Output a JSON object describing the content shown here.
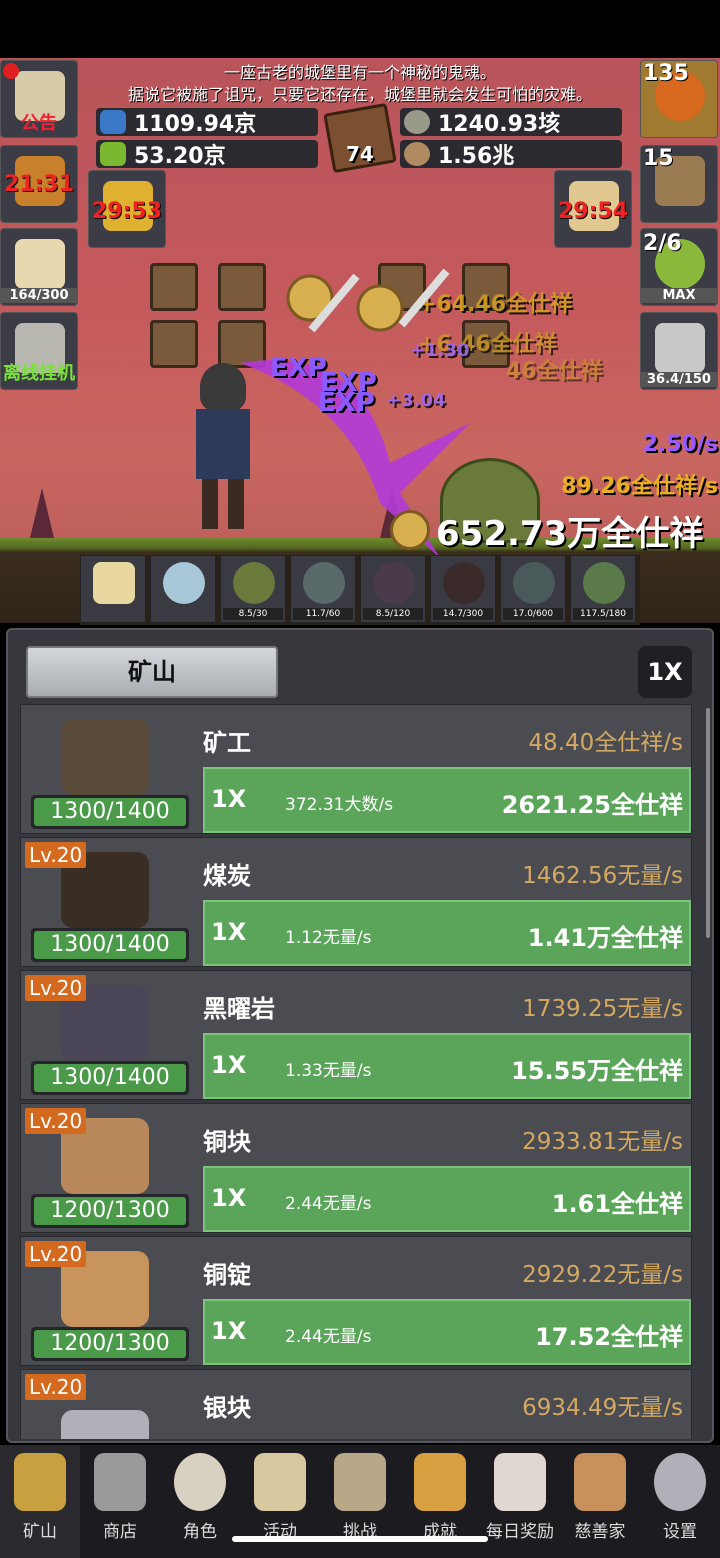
{
  "story": {
    "line1": "一座古老的城堡里有一个神秘的鬼魂。",
    "line2": "据说它被施了诅咒，只要它还存在，城堡里就会发生可怕的灾难。"
  },
  "resources": {
    "blue_potion": "1109.94京",
    "green_potion": "53.20京",
    "book_count": "74",
    "coin_a": "1240.93垓",
    "coin_b": "1.56兆"
  },
  "left_side": {
    "notice_label": "公告",
    "torch_timer": "21:31",
    "bread_count": "164/300",
    "offline_label": "离线挂机",
    "treasure_timer": "29:53"
  },
  "right_side": {
    "potion_count": "135",
    "chest_count": "15",
    "slime_count": "2/6",
    "slime_max": "MAX",
    "sword_progress": "36.4/150",
    "ticket_timer": "29:54"
  },
  "battle": {
    "dps": "2.50/s",
    "rate": "89.26全仕祥/s",
    "total": "652.73万全仕祥",
    "exp_labels": [
      "EXP",
      "EXP",
      "EXP"
    ],
    "gains": [
      "+64.46全仕祥",
      "+6.46全仕祥",
      "+1.30",
      "+3.04",
      "46全仕祥"
    ]
  },
  "enemies": [
    {
      "bar": "8.5/30",
      "color": "#6a7a3a"
    },
    {
      "bar": "11.7/60",
      "color": "#5a6a6a"
    },
    {
      "bar": "8.5/120",
      "color": "#4a3a4a"
    },
    {
      "bar": "14.7/300",
      "color": "#3a2a2a"
    },
    {
      "bar": "17.0/600",
      "color": "#4a5a5a"
    },
    {
      "bar": "117.5/180",
      "color": "#5a7a4a"
    }
  ],
  "panel": {
    "tab": "矿山",
    "speed": "1X"
  },
  "rows": [
    {
      "name": "矿工",
      "level": "",
      "count": "1300/1400",
      "rate": "48.40全仕祥/s",
      "mult": "1X",
      "sub": "372.31大数/s",
      "total": "2621.25全仕祥",
      "pic_color": "#5a4a3a"
    },
    {
      "name": "煤炭",
      "level": "Lv.20",
      "count": "1300/1400",
      "rate": "1462.56无量/s",
      "mult": "1X",
      "sub": "1.12无量/s",
      "total": "1.41万全仕祥",
      "pic_color": "#3a2e24"
    },
    {
      "name": "黑曜岩",
      "level": "Lv.20",
      "count": "1300/1400",
      "rate": "1739.25无量/s",
      "mult": "1X",
      "sub": "1.33无量/s",
      "total": "15.55万全仕祥",
      "pic_color": "#4a4658"
    },
    {
      "name": "铜块",
      "level": "Lv.20",
      "count": "1200/1300",
      "rate": "2933.81无量/s",
      "mult": "1X",
      "sub": "2.44无量/s",
      "total": "1.61全仕祥",
      "pic_color": "#b8885a"
    },
    {
      "name": "铜锭",
      "level": "Lv.20",
      "count": "1200/1300",
      "rate": "2929.22无量/s",
      "mult": "1X",
      "sub": "2.44无量/s",
      "total": "17.52全仕祥",
      "pic_color": "#c8945e"
    },
    {
      "name": "银块",
      "level": "Lv.20",
      "count": "",
      "rate": "6934.49无量/s",
      "mult": "",
      "sub": "",
      "total": "",
      "pic_color": "#b0b0b8"
    }
  ],
  "nav": [
    {
      "label": "矿山",
      "icon": "lantern-icon",
      "color": "#c9a040"
    },
    {
      "label": "商店",
      "icon": "stone-icon",
      "color": "#9a9a9a"
    },
    {
      "label": "角色",
      "icon": "skull-icon",
      "color": "#d8d0c0"
    },
    {
      "label": "活动",
      "icon": "scroll-icon",
      "color": "#d8c8a0"
    },
    {
      "label": "挑战",
      "icon": "map-icon",
      "color": "#b8a888"
    },
    {
      "label": "成就",
      "icon": "key-icon",
      "color": "#d8a040"
    },
    {
      "label": "每日奖励",
      "icon": "letter-icon",
      "color": "#e0d8d0"
    },
    {
      "label": "慈善家",
      "icon": "bread-icon",
      "color": "#c8905a"
    },
    {
      "label": "设置",
      "icon": "gear-icon",
      "color": "#b0b0b8"
    }
  ]
}
